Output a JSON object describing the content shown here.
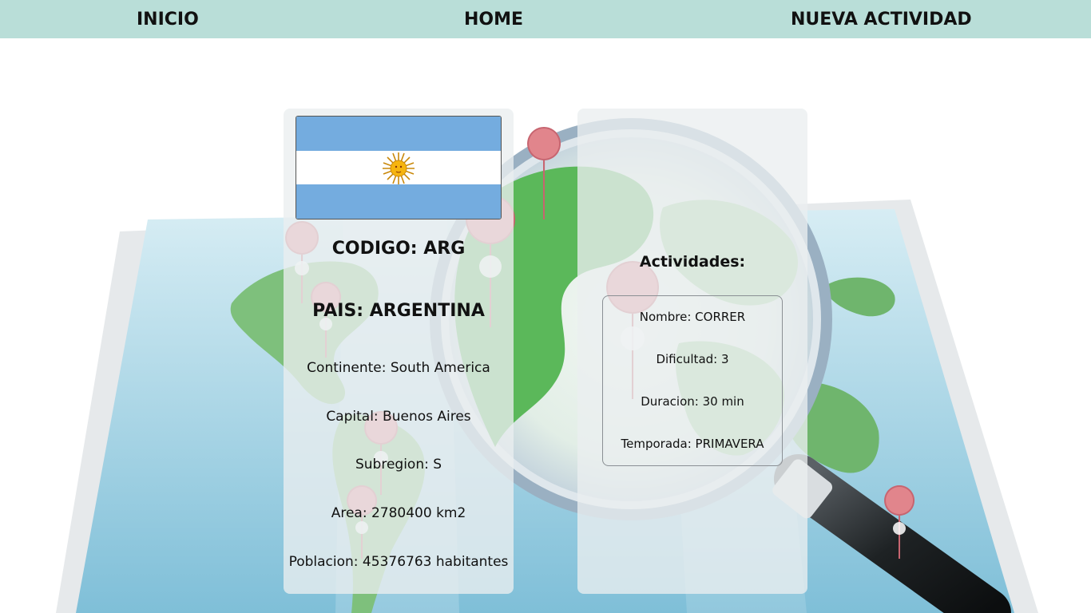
{
  "nav": {
    "inicio": "INICIO",
    "home": "HOME",
    "nueva_actividad": "NUEVA ACTIVIDAD"
  },
  "country": {
    "codigo": "CODIGO: ARG",
    "pais": "PAIS: ARGENTINA",
    "continente": "Continente: South America",
    "capital": "Capital: Buenos Aires",
    "subregion": "Subregion: S",
    "area": "Area: 2780400 km2",
    "poblacion": "Poblacion: 45376763 habitantes",
    "flag_colors": {
      "blue": "#74acdf",
      "white": "#ffffff",
      "sun": "#f6b40e"
    }
  },
  "activities": {
    "title": "Actividades:",
    "items": [
      {
        "nombre": "Nombre: CORRER",
        "dificultad": "Dificultad: 3",
        "duracion": "Duracion: 30 min",
        "temporada": "Temporada: PRIMAVERA"
      }
    ]
  },
  "theme": {
    "navbar_bg": "#b9ded8",
    "card_bg": "#ebeef0"
  }
}
